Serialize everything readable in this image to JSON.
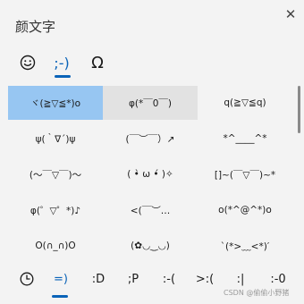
{
  "window": {
    "title": "颜文字"
  },
  "tabs": [
    {
      "label": "☺",
      "icon": "smiley-icon"
    },
    {
      "label": ";-)"
    },
    {
      "label": "Ω"
    }
  ],
  "kaomoji": [
    [
      "ヾ(≧▽≦*)o",
      "φ(*￣0￣)",
      "q(≧▽≦q)"
    ],
    [
      "ψ(｀∇´)ψ",
      "(￣︶￣）↗",
      "*^____^*"
    ],
    [
      "(～￣▽￣)～",
      "( •̀ ω •́ )✧",
      "[]~(￣▽￣)~*"
    ],
    [
      "φ(゜▽゜*)♪",
      "<(￣︶…",
      "o(*^@^*)o"
    ],
    [
      "O(∩_∩)O",
      "(✿◡‿◡)",
      "`(*>﹏<*)′"
    ]
  ],
  "categories": [
    "=)",
    ":D",
    ";P",
    ":-(",
    ">:(",
    ":|",
    ":-0"
  ],
  "watermark": "CSDN @偷偷小野猪"
}
